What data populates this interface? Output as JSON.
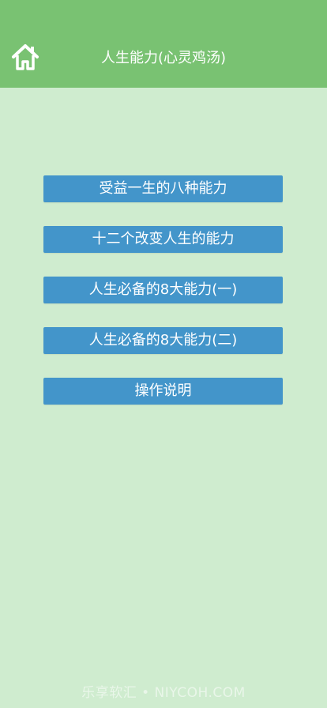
{
  "header": {
    "title": "人生能力(心灵鸡汤)",
    "home_icon": "home-icon",
    "background_color": "#79c272"
  },
  "menu": {
    "button_color": "#4395ca",
    "items": [
      {
        "label": "受益一生的八种能力"
      },
      {
        "label": "十二个改变人生的能力"
      },
      {
        "label": "人生必备的8大能力(一)"
      },
      {
        "label": "人生必备的8大能力(二)"
      },
      {
        "label": "操作说明"
      }
    ]
  },
  "watermark": {
    "text": "乐享软汇 • NIYCOH.COM"
  },
  "page": {
    "background_color": "#cfeccf"
  }
}
